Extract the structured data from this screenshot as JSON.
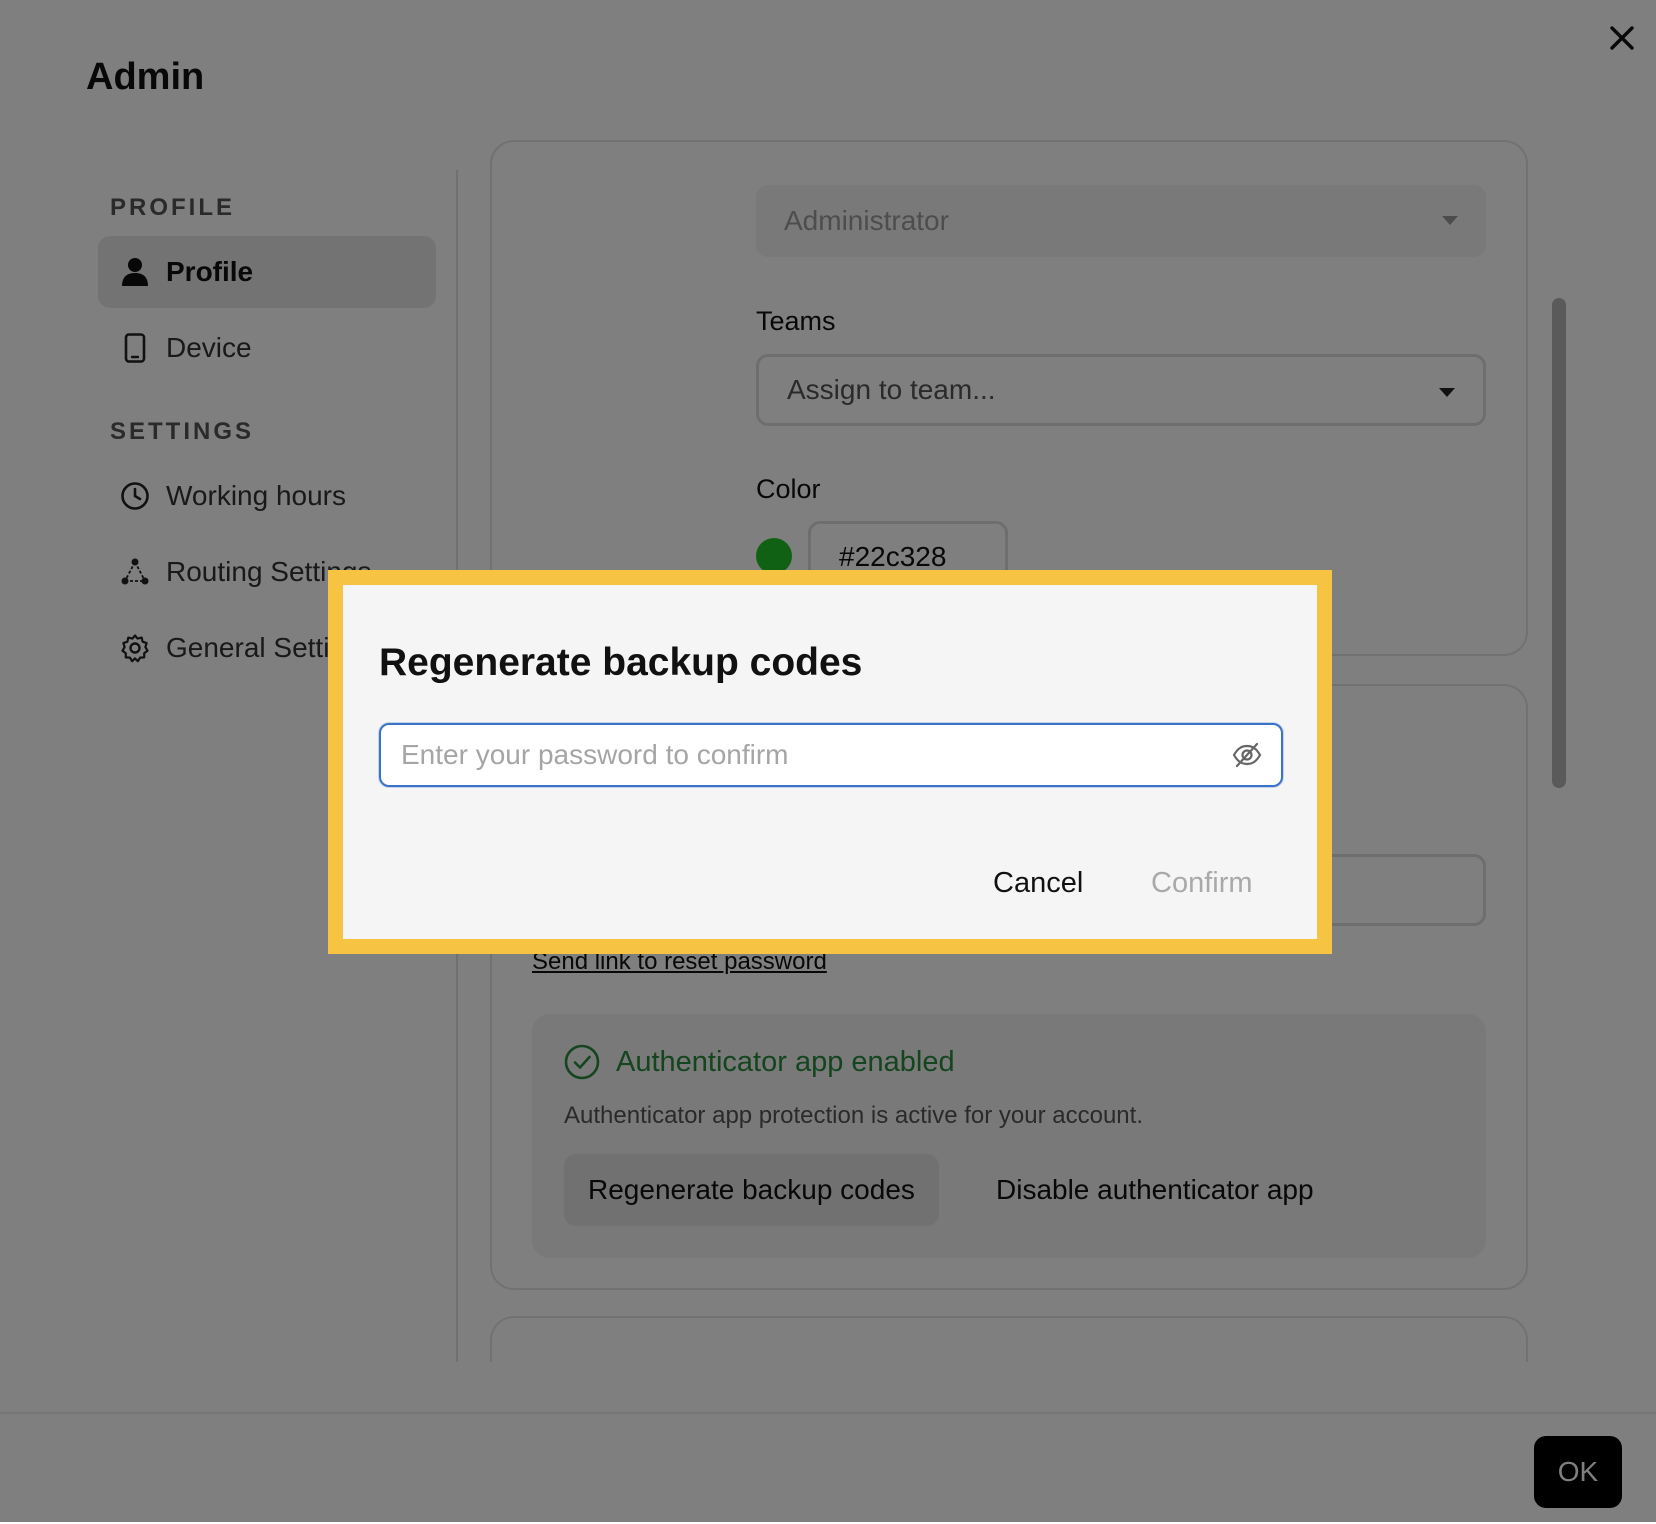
{
  "page": {
    "title": "Admin"
  },
  "sidebar": {
    "sections": [
      {
        "heading": "PROFILE",
        "items": [
          {
            "label": "Profile",
            "icon": "person-icon",
            "active": true
          },
          {
            "label": "Device",
            "icon": "phone-icon",
            "active": false
          }
        ]
      },
      {
        "heading": "SETTINGS",
        "items": [
          {
            "label": "Working hours",
            "icon": "clock-icon",
            "active": false
          },
          {
            "label": "Routing Settings",
            "icon": "routing-icon",
            "active": false
          },
          {
            "label": "General Settings",
            "icon": "gear-icon",
            "active": false
          }
        ]
      }
    ]
  },
  "main": {
    "role_select": {
      "value": "Administrator",
      "disabled": true
    },
    "teams": {
      "label": "Teams",
      "placeholder": "Assign to team..."
    },
    "color": {
      "label": "Color",
      "value": "#22c328"
    },
    "security": {
      "reset_link": "Send link to reset password",
      "authenticator": {
        "status": "Authenticator app enabled",
        "description": "Authenticator app protection is active for your account.",
        "regenerate_label": "Regenerate backup codes",
        "disable_label": "Disable authenticator app"
      }
    }
  },
  "footer": {
    "ok_label": "OK"
  },
  "dialog": {
    "title": "Regenerate backup codes",
    "password_placeholder": "Enter your password to confirm",
    "password_value": "",
    "cancel_label": "Cancel",
    "confirm_label": "Confirm"
  },
  "colors": {
    "highlight_frame": "#f6c343",
    "focus_border": "#3b73c9",
    "success": "#2b8a3e",
    "team_color": "#22c328"
  }
}
